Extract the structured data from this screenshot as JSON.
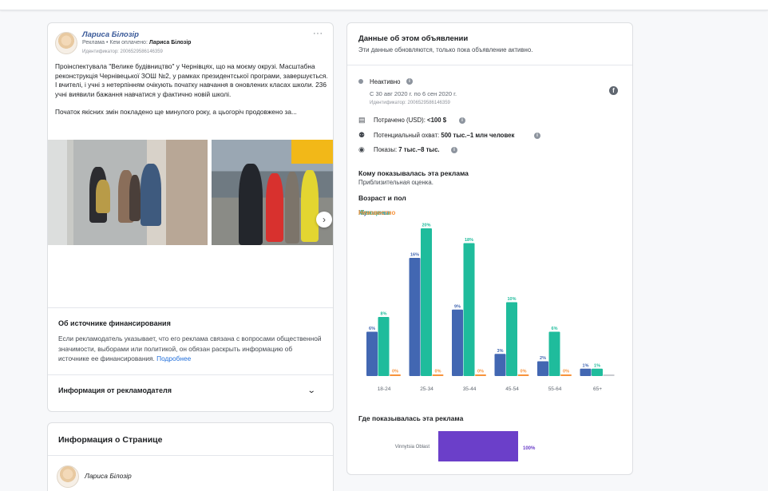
{
  "ad": {
    "advertiser": "Лариса Білозір",
    "sponsored_prefix": "Реклама • Кем оплачено: ",
    "payer": "Лариса Білозір",
    "id_line": "Идентификатор: 2006529586146359",
    "more": "···",
    "text_p1": "Проінспектувала \"Велике будівництво\" у Чернівцях, що на моєму окрузі. Масштабна реконструкція Чернівецької ЗОШ №2, у рамках президентської програми, завершується. І вчителі, і учні з нетерпінням очікують початку навчання в оновлених класах школи. 236 учні виявили бажання навчатися у фактично новій школі.",
    "text_p2": "Початок якісних змін покладено ще минулого року, а цьогоріч продовжено за...",
    "next_icon": "chevron-right-icon"
  },
  "funding": {
    "title": "Об источнике финансирования",
    "body": "Если рекламодатель указывает, что его реклама связана с вопросами общественной значимости, выборами или политикой, он обязан раскрыть информацию об источнике ее финансирования.",
    "link": "Подробнее"
  },
  "advertiser_info": {
    "title": "Информация от рекламодателя"
  },
  "page_info": {
    "title": "Информация о Странице",
    "name": "Лариса Білозір"
  },
  "details": {
    "title": "Данные об этом объявлении",
    "subtitle": "Эти данные обновляются, только пока объявление активно.",
    "status": "Неактивно",
    "dates": "С 30 авг 2020 г. по 6 сен 2020 г.",
    "id_line": "Идентификатор: 2006529586146359",
    "spent_label": "Потрачено (USD): ",
    "spent_value": "<100 $",
    "reach_label": "Потенциальный охват: ",
    "reach_value": "500 тыс.–1 млн человек",
    "impr_label": "Показы: ",
    "impr_value": "7 тыс.–8 тыс.",
    "aud_title": "Кому показывалась эта реклама",
    "aud_sub": "Приблизительная оценка.",
    "age_title": "Возраст и пол",
    "geo_title": "Где показывалась эта реклама"
  },
  "colors": {
    "men": "#4267b2",
    "women": "#1fbc9c",
    "unknown": "#f7923b",
    "zero": "#c8cbd0",
    "geo": "#6b3fc9"
  },
  "chart_data": [
    {
      "type": "bar",
      "categories": [
        "18-24",
        "25-34",
        "35-44",
        "45-54",
        "55-64",
        "65+"
      ],
      "series": [
        {
          "name": "Мужчины",
          "values": [
            6,
            16,
            9,
            3,
            2,
            1
          ]
        },
        {
          "name": "Женщины",
          "values": [
            8,
            20,
            18,
            10,
            6,
            1
          ]
        },
        {
          "name": "Неизвестно",
          "values": [
            0,
            0,
            0,
            0,
            0,
            null
          ]
        }
      ],
      "ylim": [
        0,
        20
      ],
      "legend": "top-left"
    },
    {
      "type": "bar",
      "categories": [
        "Vinnytsia Oblast"
      ],
      "values": [
        100
      ]
    }
  ]
}
